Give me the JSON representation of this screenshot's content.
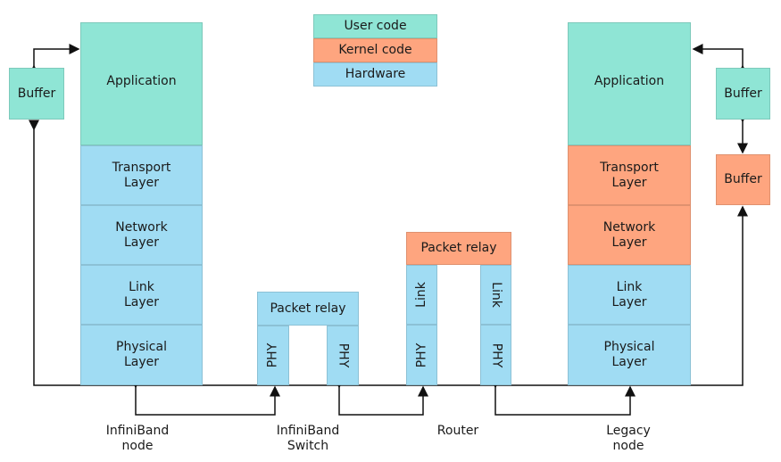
{
  "legend": {
    "user": "User code",
    "kernel": "Kernel code",
    "hardware": "Hardware"
  },
  "colors": {
    "user": "#8fe5d5",
    "kernel": "#fea57f",
    "hardware": "#a0dcf3"
  },
  "left_node": {
    "buffer": "Buffer",
    "application": "Application",
    "transport": "Transport\nLayer",
    "network": "Network\nLayer",
    "link": "Link\nLayer",
    "physical": "Physical\nLayer",
    "label": "InfiniBand\nnode"
  },
  "switch": {
    "relay": "Packet relay",
    "phy_left": "PHY",
    "phy_right": "PHY",
    "label": "InfiniBand\nSwitch"
  },
  "router": {
    "relay": "Packet relay",
    "link_left": "Link",
    "link_right": "Link",
    "phy_left": "PHY",
    "phy_right": "PHY",
    "label": "Router"
  },
  "right_node": {
    "buffer_user": "Buffer",
    "buffer_kernel": "Buffer",
    "application": "Application",
    "transport": "Transport\nLayer",
    "network": "Network\nLayer",
    "link": "Link\nLayer",
    "physical": "Physical\nLayer",
    "label": "Legacy\nnode"
  }
}
